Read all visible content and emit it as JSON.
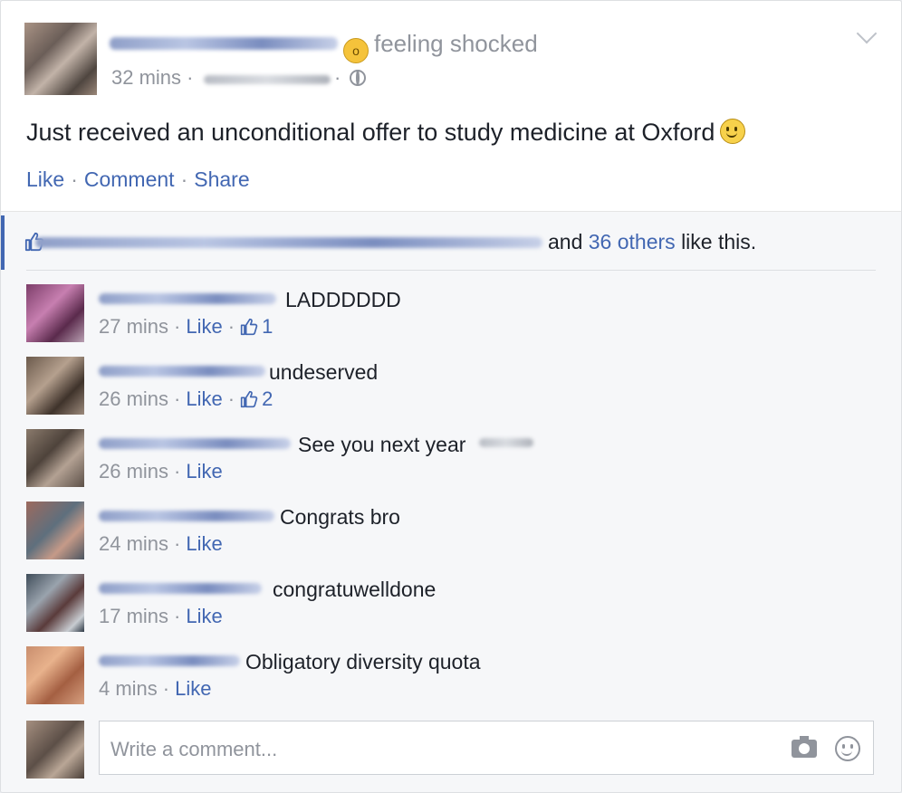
{
  "post": {
    "feeling": "feeling shocked",
    "time": "32 mins",
    "text": "Just received an unconditional offer to study medicine at Oxford",
    "actions": {
      "like": "Like",
      "comment": "Comment",
      "share": "Share"
    }
  },
  "likes": {
    "prefix": "and",
    "others": "36 others",
    "suffix": "like this."
  },
  "comments": [
    {
      "text": "LADDDDDD",
      "time": "27 mins",
      "like": "Like",
      "likes": "1"
    },
    {
      "text": "undeserved",
      "time": "26 mins",
      "like": "Like",
      "likes": "2"
    },
    {
      "text": "See you next year",
      "time": "26 mins",
      "like": "Like"
    },
    {
      "text": "Congrats bro",
      "time": "24 mins",
      "like": "Like"
    },
    {
      "text": "congratuwelldone",
      "time": "17 mins",
      "like": "Like"
    },
    {
      "text": "Obligatory diversity quota",
      "time": "4 mins",
      "like": "Like"
    }
  ],
  "composer": {
    "placeholder": "Write a comment..."
  },
  "colors": {
    "link": "#4267b2",
    "muted": "#90949c",
    "text": "#1d2129"
  }
}
